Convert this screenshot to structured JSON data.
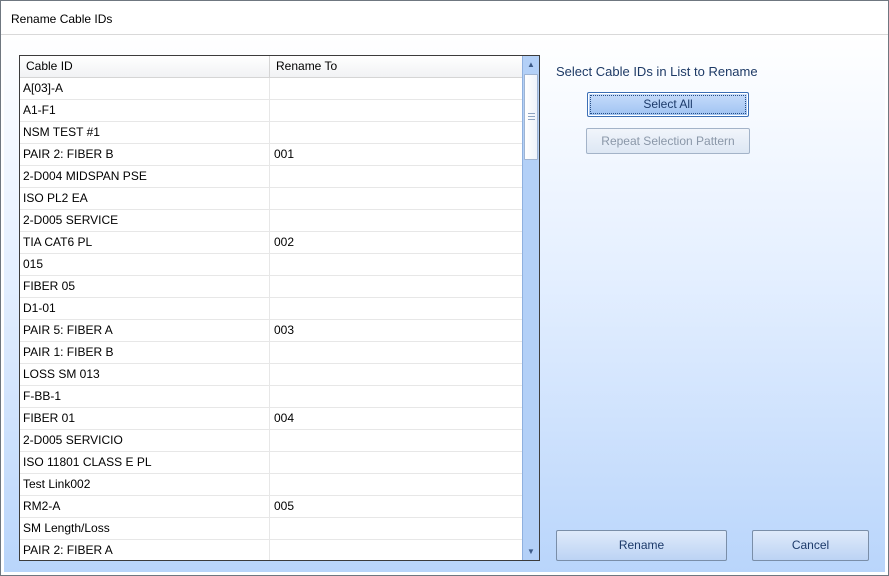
{
  "window": {
    "title": "Rename Cable IDs"
  },
  "grid": {
    "columns": [
      "Cable ID",
      "Rename To"
    ],
    "rows": [
      {
        "cable_id": "A[03]-A",
        "rename_to": ""
      },
      {
        "cable_id": "A1-F1",
        "rename_to": ""
      },
      {
        "cable_id": "NSM TEST #1",
        "rename_to": ""
      },
      {
        "cable_id": "PAIR 2: FIBER B",
        "rename_to": "001"
      },
      {
        "cable_id": "2-D004 MIDSPAN PSE",
        "rename_to": ""
      },
      {
        "cable_id": "ISO PL2 EA",
        "rename_to": ""
      },
      {
        "cable_id": "2-D005 SERVICE",
        "rename_to": ""
      },
      {
        "cable_id": "TIA CAT6 PL",
        "rename_to": "002"
      },
      {
        "cable_id": "015",
        "rename_to": ""
      },
      {
        "cable_id": "FIBER 05",
        "rename_to": ""
      },
      {
        "cable_id": "D1-01",
        "rename_to": ""
      },
      {
        "cable_id": "PAIR 5: FIBER A",
        "rename_to": "003"
      },
      {
        "cable_id": "PAIR 1: FIBER B",
        "rename_to": ""
      },
      {
        "cable_id": "LOSS SM 013",
        "rename_to": ""
      },
      {
        "cable_id": "F-BB-1",
        "rename_to": ""
      },
      {
        "cable_id": "FIBER 01",
        "rename_to": "004"
      },
      {
        "cable_id": "2-D005 SERVICIO",
        "rename_to": ""
      },
      {
        "cable_id": "ISO 11801 CLASS E PL",
        "rename_to": ""
      },
      {
        "cable_id": "Test Link002",
        "rename_to": ""
      },
      {
        "cable_id": "RM2-A",
        "rename_to": "005"
      },
      {
        "cable_id": "SM Length/Loss",
        "rename_to": ""
      },
      {
        "cable_id": "PAIR 2: FIBER A",
        "rename_to": ""
      }
    ]
  },
  "panel": {
    "prompt": "Select Cable IDs in List to Rename",
    "select_all_label": "Select All",
    "repeat_label": "Repeat Selection Pattern"
  },
  "footer": {
    "rename_label": "Rename",
    "cancel_label": "Cancel"
  },
  "icons": {
    "scroll_up": "triangle-up-icon",
    "scroll_down": "triangle-down-icon",
    "thumb_grip": "grip-icon"
  },
  "colors": {
    "accent": "#9ec2f2",
    "client_gradient_bottom": "#b9d5fb",
    "disabled_text": "#8a97a8"
  }
}
